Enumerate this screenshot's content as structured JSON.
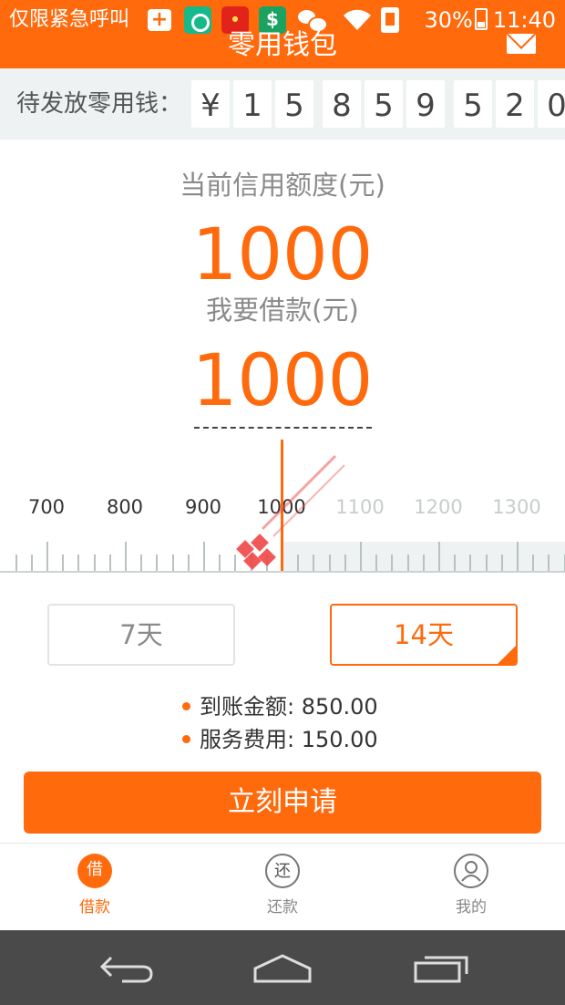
{
  "status_bar": {
    "carrier": "仅限紧急呼叫",
    "battery": "30%",
    "time": "11:40",
    "notification_icons": [
      "plus-icon",
      "green-app-icon",
      "red-app-icon",
      "s-app-icon",
      "wechat-icon"
    ]
  },
  "header": {
    "title": "零用钱包",
    "mail_icon": "mail-icon"
  },
  "pending": {
    "label": "待发放零用钱：",
    "currency": "¥",
    "digits": [
      "1",
      "5",
      "8",
      "5",
      "9",
      "5",
      "2",
      "0"
    ]
  },
  "credit": {
    "label": "当前信用额度(元)",
    "amount": "1000"
  },
  "borrow": {
    "label": "我要借款(元)",
    "amount": "1000"
  },
  "ruler": {
    "labels": [
      "700",
      "800",
      "900",
      "1000",
      "1100",
      "1200",
      "1300"
    ],
    "min": 700,
    "max": 1300,
    "selected": 1000
  },
  "duration": {
    "options": [
      "7天",
      "14天"
    ],
    "selected": "14天"
  },
  "info": {
    "received": "到账金额: 850.00",
    "fee": "服务费用: 150.00"
  },
  "apply_button": "立刻申请",
  "tabs": [
    {
      "icon_char": "借",
      "label": "借款",
      "active": true
    },
    {
      "icon_char": "还",
      "label": "还款",
      "active": false
    },
    {
      "icon_char": "",
      "label": "我的",
      "active": false
    }
  ],
  "colors": {
    "accent": "#ff6a0d",
    "panel": "#eef2f2",
    "navbar": "#4a4a4a"
  }
}
